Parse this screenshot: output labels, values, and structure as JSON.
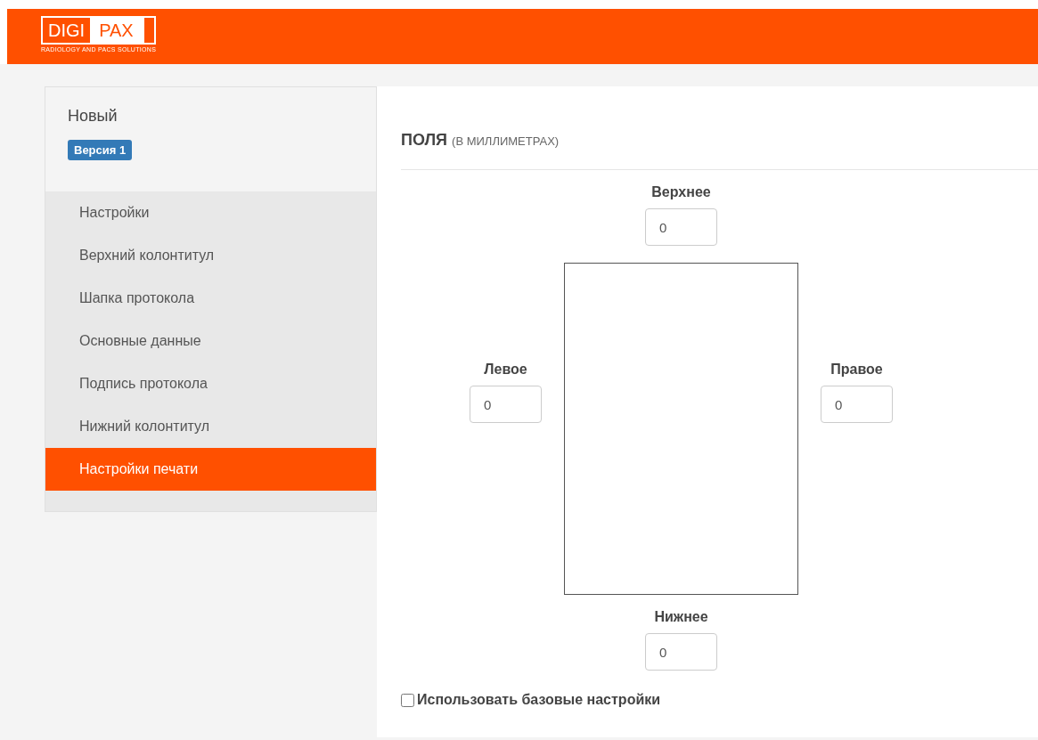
{
  "logo": {
    "left": "DIGI",
    "right": "PAX",
    "tagline": "RADIOLOGY AND PACS SOLUTIONS"
  },
  "sidebar": {
    "title": "Новый",
    "badge": "Версия 1",
    "items": [
      {
        "label": "Настройки",
        "selected": false
      },
      {
        "label": "Верхний колонтитул",
        "selected": false
      },
      {
        "label": "Шапка протокола",
        "selected": false
      },
      {
        "label": "Основные данные",
        "selected": false
      },
      {
        "label": "Подпись протокола",
        "selected": false
      },
      {
        "label": "Нижний колонтитул",
        "selected": false
      },
      {
        "label": "Настройки печати",
        "selected": true
      }
    ]
  },
  "section": {
    "title": "ПОЛЯ",
    "subtitle": "(В МИЛЛИМЕТРАХ)"
  },
  "margins": {
    "top": {
      "label": "Верхнее",
      "value": "0"
    },
    "left": {
      "label": "Левое",
      "value": "0"
    },
    "right": {
      "label": "Правое",
      "value": "0"
    },
    "bottom": {
      "label": "Нижнее",
      "value": "0"
    }
  },
  "use_base": {
    "label": "Использовать базовые настройки",
    "checked": false
  }
}
